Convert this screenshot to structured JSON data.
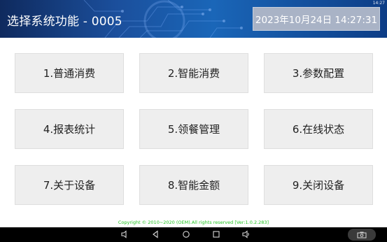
{
  "status_bar": {
    "time": "14:27"
  },
  "header": {
    "title": "选择系统功能 - 0005",
    "datetime": "2023年10月24日 14:27:31"
  },
  "menu": {
    "buttons": [
      {
        "label": "1.普通消费"
      },
      {
        "label": "2.智能消费"
      },
      {
        "label": "3.参数配置"
      },
      {
        "label": "4.报表统计"
      },
      {
        "label": "5.领餐管理"
      },
      {
        "label": "6.在线状态"
      },
      {
        "label": "7.关于设备"
      },
      {
        "label": "8.智能金额"
      },
      {
        "label": "9.关闭设备"
      }
    ]
  },
  "footer": {
    "copyright": "Copyright © 2010~2020 (OEM).All rights reserved [Ver:1.0.2.283]"
  },
  "navbar": {
    "icons": [
      "volume-down-icon",
      "back-icon",
      "home-icon",
      "recents-icon",
      "volume-up-icon",
      "screenshot-icon"
    ]
  },
  "colors": {
    "header_bg": "#1b4f9c",
    "datetime_box": "#a9b3c6",
    "button_bg": "#eeeeee",
    "copyright_text": "#22c522"
  }
}
